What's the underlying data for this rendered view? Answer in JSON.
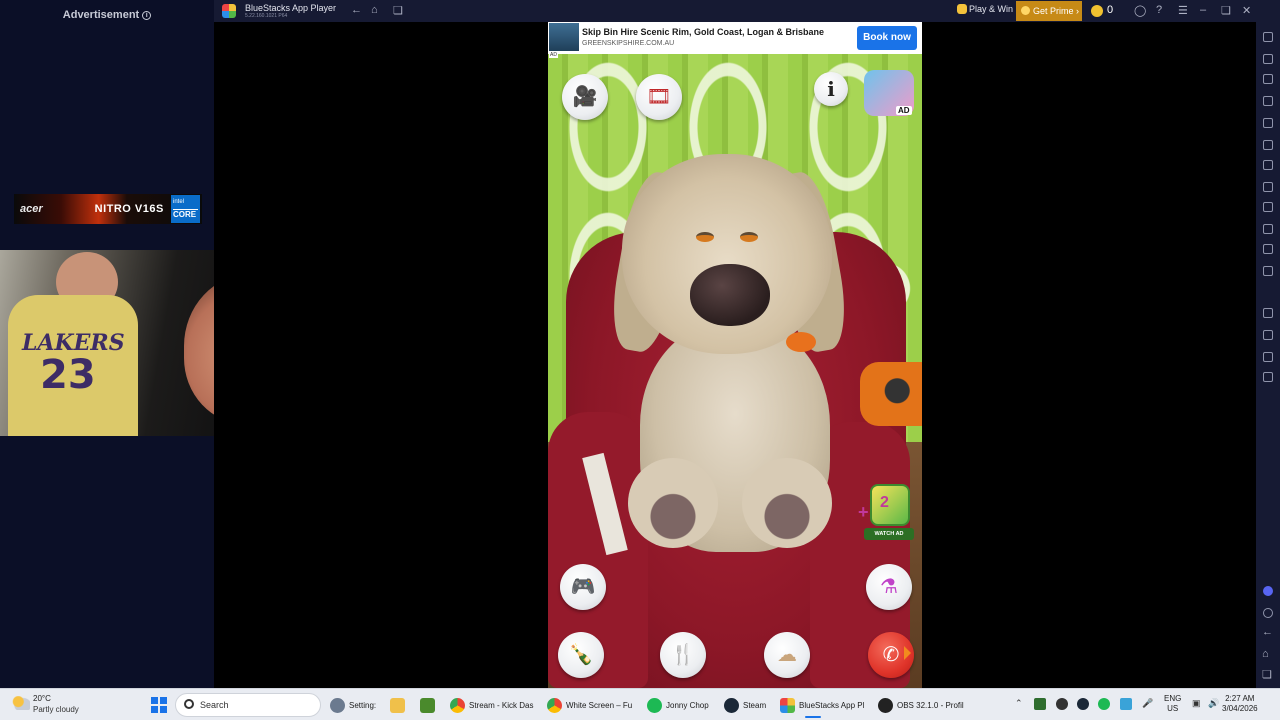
{
  "left_ad": {
    "label": "Advertisement",
    "banner_brand": "acer",
    "banner_model": "NITRO V16S",
    "badge_brand": "intel",
    "badge_line": "CORE"
  },
  "webcam": {
    "shirt_text": "LAKERS",
    "shirt_number": "23"
  },
  "bluestacks": {
    "title": "BlueStacks App Player",
    "version": "5.22.160.1021 P64",
    "play_win": "Play & Win",
    "get_prime": "Get Prime",
    "coins": "0"
  },
  "game": {
    "ad_headline": "Skip Bin Hire Scenic Rim, Gold Coast, Logan & Brisbane",
    "ad_domain": "GREENSKIPSHIRE.COM.AU",
    "ad_cta": "Book now",
    "ad_tag": "AD",
    "promo_badge": "AD",
    "watch_ad_label": "WATCH AD",
    "watch_ad_plus": "+",
    "watch_ad_count": "2",
    "info_glyph": "i"
  },
  "taskbar": {
    "weather_temp": "20°C",
    "weather_desc": "Partly cloudy",
    "search_placeholder": "Search",
    "apps": [
      {
        "label": "Setting:"
      },
      {
        "label": ""
      },
      {
        "label": ""
      },
      {
        "label": "Stream - Kick Das"
      },
      {
        "label": "White Screen – Fu"
      },
      {
        "label": "Jonny Chop"
      },
      {
        "label": "Steam"
      },
      {
        "label": "BlueStacks App Pl"
      },
      {
        "label": "OBS 32.1.0 - Profil"
      }
    ],
    "lang_top": "ENG",
    "lang_bottom": "US",
    "time": "2:27 AM",
    "date": "3/04/2026"
  },
  "icons": [
    "info-icon",
    "back-icon",
    "home-icon",
    "multitask-icon",
    "account-icon",
    "help-icon",
    "menu-icon",
    "minimize-icon",
    "restore-icon",
    "close-icon",
    "video-camera-icon",
    "video-player-icon",
    "gamepad-icon",
    "potion-flask-icon",
    "milk-bottle-icon",
    "fork-knife-icon",
    "toilet-paper-icon",
    "phone-call-icon",
    "windows-start-icon",
    "search-icon",
    "weather-icon"
  ],
  "colors": {
    "titlebar": "#161a33",
    "ad_cta": "#1a73e8",
    "prime": "#c78a16",
    "call_button": "#e0342a",
    "wall_green": "#9ccf4a",
    "chair_red": "#8c1727"
  }
}
